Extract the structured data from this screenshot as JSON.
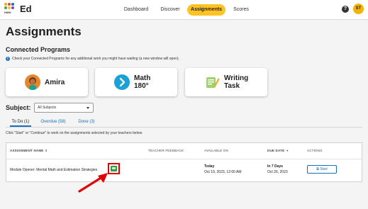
{
  "header": {
    "brand_label": "HMH",
    "app_name": "Ed",
    "nav": [
      {
        "label": "Dashboard"
      },
      {
        "label": "Discover"
      },
      {
        "label": "Assignments"
      },
      {
        "label": "Scores"
      }
    ],
    "help_icon": "?",
    "avatar_initials": "ST"
  },
  "page": {
    "title": "Assignments",
    "connected_title": "Connected Programs",
    "connected_info": "Check your Connected Programs for any additional work you might have waiting (a new window will open).",
    "info_icon": "i"
  },
  "programs": [
    {
      "name": "Amira",
      "icon": "amira-icon"
    },
    {
      "name_line1": "Math",
      "name_line2": "180°",
      "icon": "math180-icon"
    },
    {
      "name_line1": "Writing",
      "name_line2": "Task",
      "icon": "writing-task-icon"
    }
  ],
  "subject": {
    "label": "Subject:",
    "selected": "All Subjects"
  },
  "tabs": [
    {
      "label": "To Do (1)"
    },
    {
      "label": "Overdue (58)"
    },
    {
      "label": "Done (3)"
    }
  ],
  "instructions": "Click \"Start\" or \"Continue\" to work on the assignments selected by your teachers below.",
  "table": {
    "headers": {
      "name": "ASSIGNMENT NAME",
      "feedback": "TEACHER FEEDBACK",
      "available": "AVAILABLE ON",
      "due": "DUE DATE",
      "actions": "ACTIONS"
    },
    "rows": [
      {
        "name": "Module Opener: Mental Math and Estimation Strategies",
        "available_day": "Today",
        "available_date": "Oct 19, 2023, 12:00 AM",
        "due_day": "In 7 Days",
        "due_date": "Oct 26, 2023",
        "action_label": "Start"
      }
    ]
  },
  "colors": {
    "accent_yellow": "#ffc324",
    "link_blue": "#1b6fc2",
    "highlight_red": "#e00000",
    "content_icon_green": "#2e9a48"
  }
}
